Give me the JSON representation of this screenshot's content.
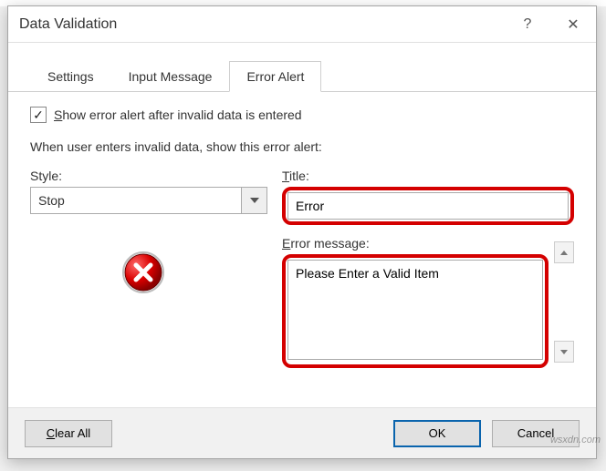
{
  "window": {
    "title": "Data Validation",
    "help": "?",
    "close": "✕"
  },
  "tabs": {
    "t0": "Settings",
    "t1": "Input Message",
    "t2": "Error Alert"
  },
  "content": {
    "checkbox": {
      "checked": "✓",
      "label_prefix": "S",
      "label_rest": "how error alert after invalid data is entered"
    },
    "instruction": "When user enters invalid data, show this error alert:",
    "style": {
      "label": "Style:",
      "value": "Stop"
    },
    "title": {
      "label_prefix": "T",
      "label_rest": "itle:",
      "value": "Error"
    },
    "error_msg": {
      "label_prefix": "E",
      "label_rest": "rror message:",
      "value": "Please Enter a Valid Item"
    }
  },
  "footer": {
    "clear_prefix": "C",
    "clear_rest": "lear All",
    "ok": "OK",
    "cancel": "Cancel"
  },
  "watermark": "wsxdn.com"
}
